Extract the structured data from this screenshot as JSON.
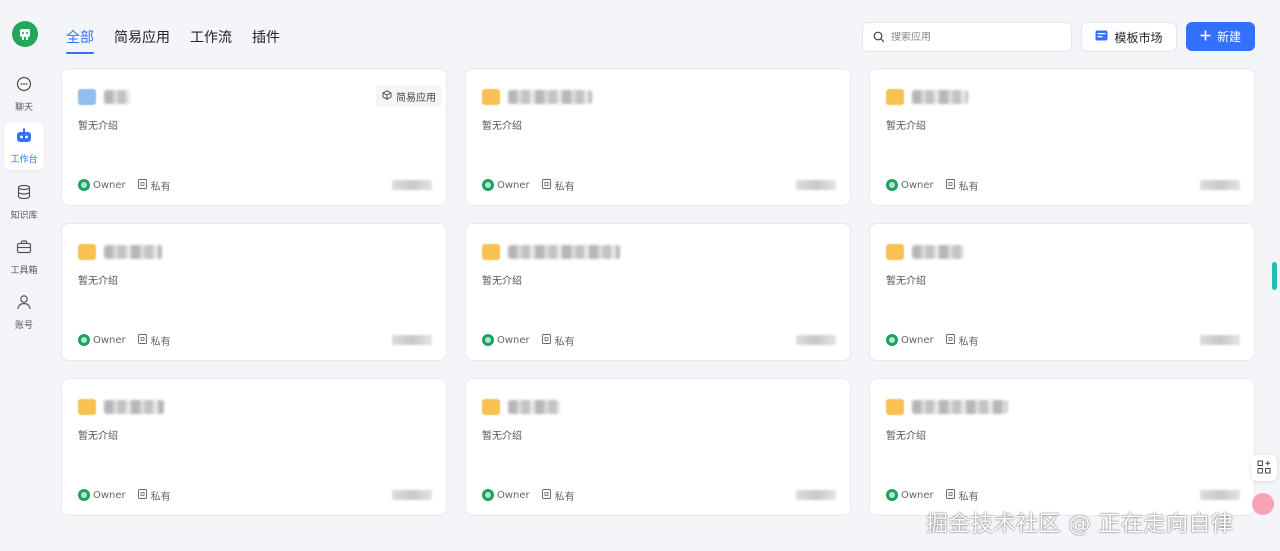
{
  "sidebar": {
    "items": [
      {
        "label": "聊天",
        "icon": "chat-icon"
      },
      {
        "label": "工作台",
        "icon": "robot-icon",
        "active": true
      },
      {
        "label": "知识库",
        "icon": "database-icon"
      },
      {
        "label": "工具箱",
        "icon": "toolbox-icon"
      },
      {
        "label": "账号",
        "icon": "user-icon"
      }
    ]
  },
  "tabs": [
    {
      "label": "全部",
      "active": true
    },
    {
      "label": "简易应用"
    },
    {
      "label": "工作流"
    },
    {
      "label": "插件"
    }
  ],
  "search": {
    "placeholder": "搜索应用"
  },
  "toolbar": {
    "template_label": "模板市场",
    "new_label": "新建"
  },
  "cards": [
    {
      "tag": "简易应用",
      "desc": "暂无介绍",
      "owner": "Owner",
      "visibility": "私有"
    },
    {
      "desc": "暂无介绍",
      "owner": "Owner",
      "visibility": "私有"
    },
    {
      "desc": "暂无介绍",
      "owner": "Owner",
      "visibility": "私有"
    },
    {
      "desc": "暂无介绍",
      "owner": "Owner",
      "visibility": "私有"
    },
    {
      "desc": "暂无介绍",
      "owner": "Owner",
      "visibility": "私有"
    },
    {
      "desc": "暂无介绍",
      "owner": "Owner",
      "visibility": "私有"
    },
    {
      "desc": "暂无介绍",
      "owner": "Owner",
      "visibility": "私有"
    },
    {
      "desc": "暂无介绍",
      "owner": "Owner",
      "visibility": "私有"
    },
    {
      "desc": "暂无介绍",
      "owner": "Owner",
      "visibility": "私有"
    }
  ],
  "watermark": "掘金技术社区 @ 正在走向自律",
  "colors": {
    "accent": "#3370ff",
    "brand": "#23a75a",
    "folder": "#f8b733"
  }
}
